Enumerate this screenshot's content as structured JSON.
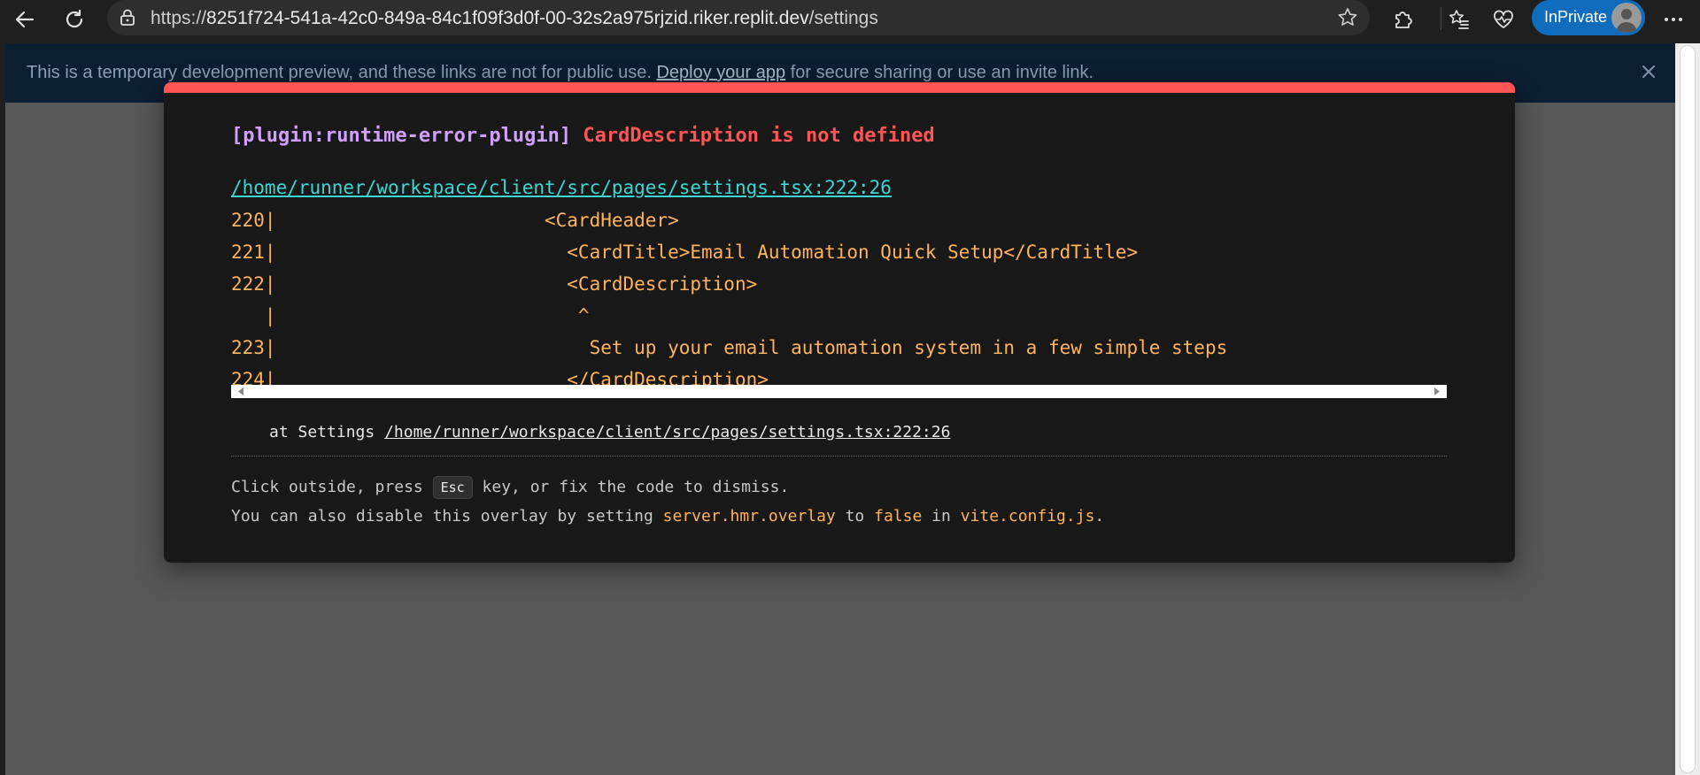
{
  "browser": {
    "url_prefix": "https://",
    "url_host": "8251f724-541a-42c0-849a-84c1f09f3d0f-00-32s2a975rjzid.riker.replit.dev",
    "url_path": "/settings",
    "inprivate_label": "InPrivate"
  },
  "banner": {
    "text_before": "This is a temporary development preview, and these links are not for public use.",
    "deploy_link": "Deploy your app",
    "text_after": "for secure sharing or use an invite link."
  },
  "overlay": {
    "plugin": "[plugin:runtime-error-plugin]",
    "message": "CardDescription is not defined",
    "file": "/home/runner/workspace/client/src/pages/settings.tsx:222:26",
    "code_lines": [
      "220|                        <CardHeader>",
      "221|                          <CardTitle>Email Automation Quick Setup</CardTitle>",
      "222|                          <CardDescription>",
      "   |                           ^",
      "223|                            Set up your email automation system in a few simple steps",
      "224|                          </CardDescription>"
    ],
    "stack_prefix": "at Settings",
    "stack_location": "/home/runner/workspace/client/src/pages/settings.tsx:222:26",
    "tip1_before": "Click outside, press",
    "tip1_key": "Esc",
    "tip1_after": "key, or fix the code to dismiss.",
    "tip2_before": "You can also disable this overlay by setting",
    "tip2_setting": "server.hmr.overlay",
    "tip2_to": "to",
    "tip2_value": "false",
    "tip2_in": "in",
    "tip2_file": "vite.config.js",
    "tip2_end": "."
  },
  "colors": {
    "error_red": "#ff5555",
    "plugin_purple": "#cfa0ff",
    "code_orange": "#ffb45c",
    "link_cyan": "#3dd6d0",
    "inprivate_blue": "#0f6cbd"
  }
}
